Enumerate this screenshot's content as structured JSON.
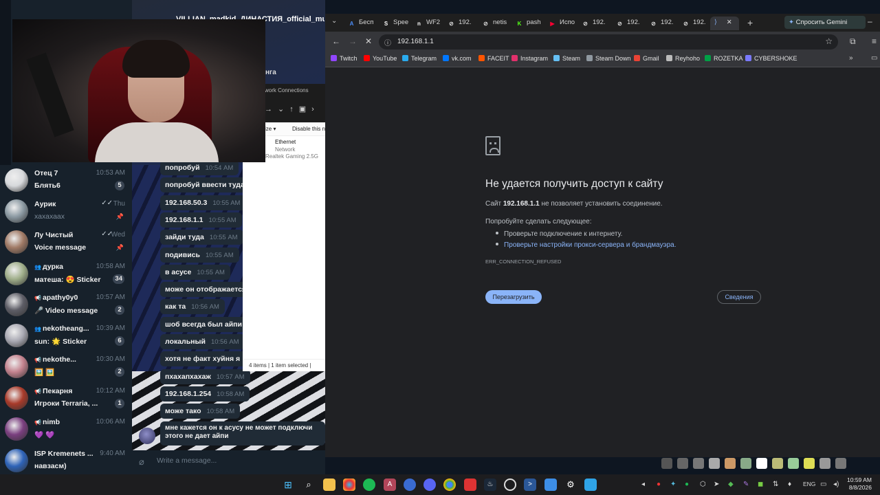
{
  "telegram": {
    "chat_title": "VILLIAN_madkid_ДИНАСТИЯ_official_mus",
    "chat_subtitle_fragment": "нга",
    "input_placeholder": "Write a message...",
    "chats": [
      {
        "name": "Отец 7",
        "preview": "Блять6",
        "time": "10:53 AM",
        "badge": "5",
        "avatar_color": "#d7d9dc"
      },
      {
        "name": "Аурик",
        "preview": "хахахаах",
        "time": "Thu",
        "ticks": "✓✓",
        "pinned": true,
        "avatar_color": "#8c9aa3"
      },
      {
        "name": "Лу Чистый",
        "preview": "Voice message",
        "time": "Wed",
        "ticks": "✓✓",
        "pinned": true,
        "avatar_color": "#a07a66"
      },
      {
        "name": "дурка",
        "preview": "матеша: 😍 Sticker",
        "time": "10:58 AM",
        "badge": "34",
        "group": true,
        "avatar_color": "#9fae8a"
      },
      {
        "name": "apathy0y0",
        "preview": "🎤 Video message",
        "time": "10:57 AM",
        "badge": "2",
        "channel": true,
        "avatar_color": "#5d5d66"
      },
      {
        "name": "nekotheang...",
        "preview": "sun: 🌟 Sticker",
        "time": "10:39 AM",
        "badge": "6",
        "group": true,
        "avatar_color": "#a9a9b3"
      },
      {
        "name": "nekothe...",
        "preview": "🖼️ 🖼️",
        "time": "10:30 AM",
        "badge": "2",
        "channel": true,
        "avatar_color": "#c3828e"
      },
      {
        "name": "Пекарня",
        "preview": "Игроки Terraria, ...",
        "time": "10:12 AM",
        "badge": "1",
        "channel": true,
        "avatar_color": "#a83a2a"
      },
      {
        "name": "nimb",
        "preview": "💜 💜",
        "time": "10:06 AM",
        "channel": true,
        "avatar_color": "#7a3f7f"
      },
      {
        "name": "ISP Kremenets ...",
        "preview": "навзасм)",
        "time": "9:40 AM",
        "avatar_color": "#2e63b8"
      }
    ],
    "messages": [
      {
        "text": "попробуй",
        "time": "10:54 AM"
      },
      {
        "text": "попробуй ввести туда",
        "time": ""
      },
      {
        "text": "192.168.50.3",
        "time": "10:55 AM"
      },
      {
        "text": "192.168.1.1",
        "time": "10:55 AM"
      },
      {
        "text": "зайди туда",
        "time": "10:55 AM"
      },
      {
        "text": "подивись",
        "time": "10:55 AM"
      },
      {
        "text": "в асусе",
        "time": "10:55 AM"
      },
      {
        "text": "може он отображается",
        "time": ""
      },
      {
        "text": "как та",
        "time": "10:56 AM"
      },
      {
        "text": "шоб всегда был айпи",
        "time": ""
      },
      {
        "text": "локальный",
        "time": "10:56 AM"
      },
      {
        "text": "хотя не факт хуйня я",
        "time": ""
      },
      {
        "text": "пхахапхахаж",
        "time": "10:57 AM"
      },
      {
        "text": "192.168.1.254",
        "time": "10:58 AM"
      },
      {
        "text": "може тако",
        "time": "10:58 AM"
      }
    ],
    "last_message_line1": "мне кажется он к асусу не может подключи",
    "last_message_line2": "этого не дает айпи"
  },
  "explorer": {
    "breadcrumb": "work Connections",
    "organize": "ize ▾",
    "disable": "Disable this n",
    "item_name": "Ethernet",
    "item_type": "Network",
    "item_device": "Realtek Gaming 2.5G",
    "status": "4 items  |  1 item selected  |"
  },
  "chrome": {
    "tabs": [
      {
        "label": "Бесп",
        "fav_color": "#4b8cf5",
        "fav": "A"
      },
      {
        "label": "Spee",
        "fav_color": "#ffffff",
        "fav": "S"
      },
      {
        "label": "WF2",
        "fav_color": "#ffffff",
        "fav": "n"
      },
      {
        "label": "192.",
        "fav_color": "#dcdcdc",
        "fav": "⊘"
      },
      {
        "label": "netis",
        "fav_color": "#dcdcdc",
        "fav": "⊘"
      },
      {
        "label": "pash",
        "fav_color": "#53fc18",
        "fav": "K"
      },
      {
        "label": "Испо",
        "fav_color": "#ff0033",
        "fav": "▶"
      },
      {
        "label": "192.",
        "fav_color": "#dcdcdc",
        "fav": "⊘"
      },
      {
        "label": "192.",
        "fav_color": "#dcdcdc",
        "fav": "⊘"
      },
      {
        "label": "192.",
        "fav_color": "#dcdcdc",
        "fav": "⊘"
      },
      {
        "label": "192.",
        "fav_color": "#dcdcdc",
        "fav": "⊘"
      }
    ],
    "gemini_button": "Спросить Gemini",
    "url": "192.168.1.1",
    "bookmarks": [
      {
        "label": "Twitch",
        "color": "#9146ff"
      },
      {
        "label": "YouTube",
        "color": "#ff0000"
      },
      {
        "label": "Telegram",
        "color": "#2aabee"
      },
      {
        "label": "vk.com",
        "color": "#0077ff"
      },
      {
        "label": "FACEIT",
        "color": "#ff5500"
      },
      {
        "label": "Instagram",
        "color": "#e1306c"
      },
      {
        "label": "Steam",
        "color": "#66c0f4"
      },
      {
        "label": "Steam Down",
        "color": "#8f98a0"
      },
      {
        "label": "Gmail",
        "color": "#ea4335"
      },
      {
        "label": "Reyhoho",
        "color": "#bbbbbb"
      },
      {
        "label": "ROZETKA",
        "color": "#00a046"
      },
      {
        "label": "CYBERSHOKE",
        "color": "#7a7aff"
      }
    ],
    "error": {
      "title": "Не удается получить доступ к сайту",
      "line_prefix": "Сайт",
      "line_host": "192.168.1.1",
      "line_suffix": "не позволяет установить соединение.",
      "try_heading": "Попробуйте сделать следующее:",
      "suggestion1": "Проверьте подключение к интернету.",
      "suggestion2": "Проверьте настройки прокси-сервера и брандмауэра.",
      "code": "ERR_CONNECTION_REFUSED",
      "reload_button": "Перезагрузить",
      "details_button": "Сведения"
    }
  },
  "taskbar": {
    "language": "ENG",
    "time": "10:59 AM",
    "date": "8/8/2026"
  }
}
